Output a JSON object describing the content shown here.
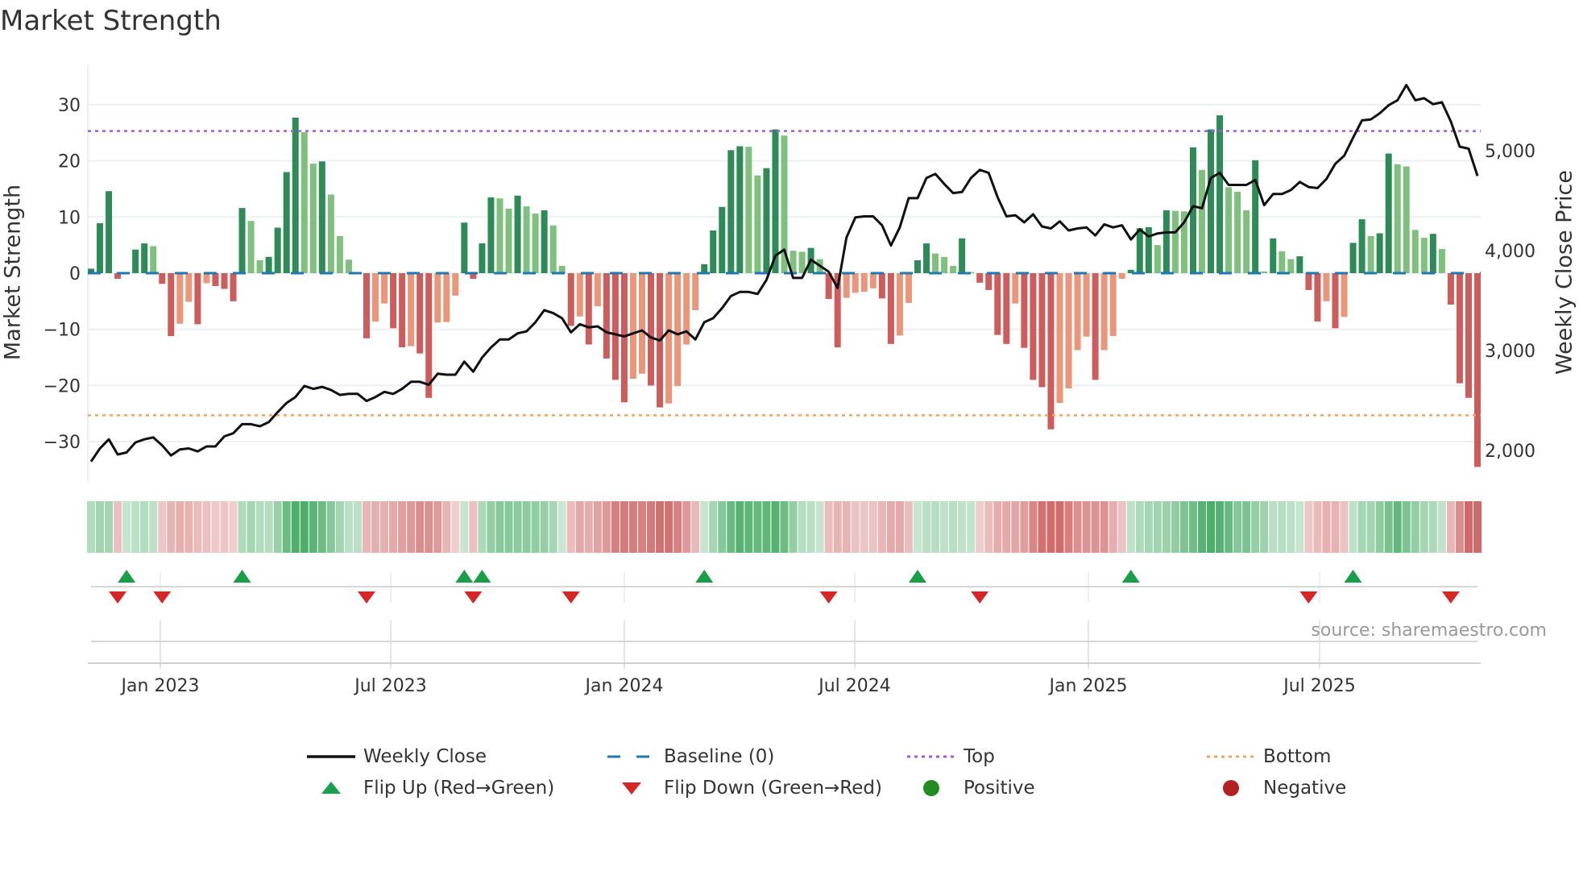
{
  "title": "Market Strength",
  "source": "source: sharemaestro.com",
  "colors": {
    "pos_strong": "#2e8b57",
    "pos_weak": "#80c07e",
    "neg_strong": "#cd5c5c",
    "neg_weak": "#e9967a",
    "heat_pos": "46,160,80",
    "heat_neg": "200,80,80",
    "line": "#111111",
    "baseline": "#1f77b4",
    "top": "#9b5de5",
    "bottom": "#f4a460",
    "flip_up": "#1a9e4a",
    "flip_down": "#d62728",
    "positive": "#228b22",
    "negative": "#b22222"
  },
  "chart_data": {
    "type": "bar",
    "title": "Market Strength",
    "ylabel": "Market Strength",
    "y2label": "Weekly Close Price",
    "ylim": [
      -37,
      37
    ],
    "y2lim": [
      1700,
      5800
    ],
    "yticks": [
      "30",
      "20",
      "10",
      "0",
      "−10",
      "−20",
      "−30"
    ],
    "ytick_values": [
      30,
      20,
      10,
      0,
      -10,
      -20,
      -30
    ],
    "y2ticks": [
      "5,000",
      "4,000",
      "3,000",
      "2,000"
    ],
    "y2tick_values": [
      5000,
      4000,
      3000,
      2000
    ],
    "xticks": [
      "Jan 2023",
      "Jul 2023",
      "Jan 2024",
      "Jul 2024",
      "Jan 2025",
      "Jul 2025"
    ],
    "top_level": 25.3,
    "bottom_level": -25.3,
    "baseline": 0,
    "grid": true,
    "legend_placement": "bottom",
    "strength": [
      0.8,
      8.9,
      14.6,
      -1.0,
      0.2,
      4.2,
      5.3,
      4.8,
      -1.9,
      -11.2,
      -9.0,
      -5.1,
      -9.1,
      -1.8,
      -2.3,
      -2.8,
      -5.0,
      11.6,
      9.3,
      2.3,
      2.9,
      8.1,
      18.0,
      27.7,
      25.1,
      19.5,
      19.9,
      14.0,
      6.6,
      2.4,
      0.2,
      -11.6,
      -8.6,
      -5.4,
      -9.8,
      -13.2,
      -13.0,
      -14.3,
      -22.2,
      -8.8,
      -8.7,
      -4.0,
      9.0,
      -1.0,
      5.3,
      13.5,
      13.3,
      11.5,
      13.8,
      11.9,
      10.6,
      11.2,
      8.5,
      1.3,
      -9.4,
      -7.7,
      -12.7,
      -5.9,
      -15.2,
      -19.0,
      -23.0,
      -18.8,
      -17.9,
      -20.0,
      -23.9,
      -23.2,
      -20.1,
      -12.7,
      -6.6,
      1.6,
      7.6,
      11.8,
      21.9,
      22.6,
      22.5,
      17.4,
      18.7,
      25.6,
      24.5,
      4.0,
      3.8,
      4.5,
      2.5,
      -4.6,
      -13.2,
      -4.4,
      -3.5,
      -3.3,
      -2.7,
      -4.5,
      -12.6,
      -11.1,
      -5.3,
      2.3,
      5.3,
      3.5,
      2.9,
      1.3,
      6.2,
      0.2,
      -1.7,
      -3.0,
      -11.0,
      -12.6,
      -5.4,
      -13.3,
      -19.0,
      -20.3,
      -27.8,
      -23.1,
      -20.5,
      -13.7,
      -11.3,
      -19.0,
      -13.7,
      -11.2,
      -1.0,
      0.6,
      8.0,
      8.2,
      5.0,
      11.2,
      11.1,
      11.0,
      22.4,
      18.4,
      25.6,
      28.1,
      15.3,
      14.5,
      11.2,
      20.1,
      0.3,
      6.2,
      3.9,
      2.5,
      3.0,
      -3.0,
      -8.6,
      -5.0,
      -9.8,
      -7.8,
      5.4,
      9.6,
      6.6,
      7.1,
      21.3,
      19.4,
      19.0,
      7.7,
      6.3,
      7.0,
      4.3,
      -5.6,
      -19.6,
      -22.2,
      -34.5
    ],
    "weekly_close": [
      1889,
      2020,
      2111,
      1960,
      1980,
      2081,
      2111,
      2131,
      2051,
      1950,
      2010,
      2020,
      1990,
      2040,
      2040,
      2141,
      2172,
      2263,
      2263,
      2242,
      2283,
      2384,
      2475,
      2535,
      2646,
      2616,
      2636,
      2606,
      2556,
      2566,
      2566,
      2495,
      2535,
      2586,
      2566,
      2616,
      2687,
      2687,
      2657,
      2768,
      2758,
      2758,
      2889,
      2788,
      2929,
      3030,
      3111,
      3111,
      3172,
      3192,
      3283,
      3404,
      3374,
      3323,
      3182,
      3263,
      3232,
      3242,
      3182,
      3162,
      3141,
      3172,
      3202,
      3131,
      3101,
      3202,
      3162,
      3192,
      3111,
      3283,
      3323,
      3424,
      3545,
      3586,
      3586,
      3566,
      3707,
      3949,
      4010,
      3727,
      3727,
      3909,
      3848,
      3788,
      3626,
      4131,
      4333,
      4343,
      4343,
      4253,
      4051,
      4232,
      4525,
      4525,
      4727,
      4768,
      4667,
      4576,
      4586,
      4727,
      4808,
      4778,
      4535,
      4343,
      4354,
      4283,
      4364,
      4242,
      4222,
      4293,
      4202,
      4222,
      4232,
      4152,
      4263,
      4232,
      4253,
      4111,
      4212,
      4141,
      4172,
      4182,
      4182,
      4283,
      4444,
      4424,
      4727,
      4778,
      4657,
      4657,
      4657,
      4707,
      4455,
      4566,
      4566,
      4606,
      4687,
      4636,
      4626,
      4717,
      4869,
      4949,
      5131,
      5303,
      5313,
      5374,
      5455,
      5505,
      5657,
      5505,
      5525,
      5465,
      5485,
      5293,
      5040,
      5020,
      4747
    ]
  },
  "legend": [
    {
      "label": "Weekly Close",
      "icon": "solid-line"
    },
    {
      "label": "Baseline (0)",
      "icon": "dashed-line"
    },
    {
      "label": "Top",
      "icon": "dotted-line"
    },
    {
      "label": "Bottom",
      "icon": "dotted-line"
    },
    {
      "label": "Flip Up (Red→Green)",
      "icon": "triangle-up"
    },
    {
      "label": "Flip Down (Green→Red)",
      "icon": "triangle-down"
    },
    {
      "label": "Positive",
      "icon": "circle"
    },
    {
      "label": "Negative",
      "icon": "circle"
    }
  ]
}
